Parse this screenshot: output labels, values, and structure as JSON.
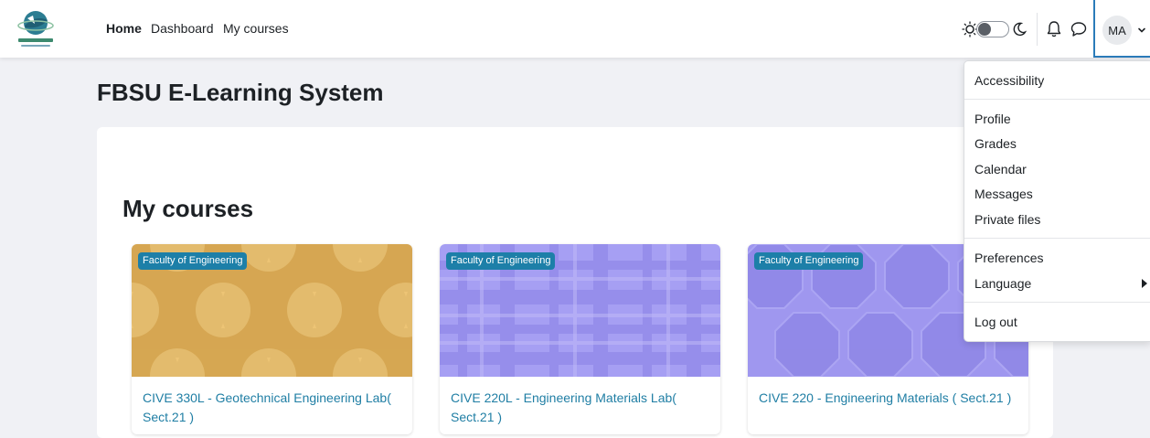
{
  "navbar": {
    "logo_icon": "university-logo-icon",
    "links": [
      {
        "label": "Home",
        "active": true
      },
      {
        "label": "Dashboard",
        "active": false
      },
      {
        "label": "My courses",
        "active": false
      }
    ],
    "theme_toggle": {
      "sun_icon": "sun-icon",
      "moon_icon": "moon-icon",
      "dark_mode": false
    },
    "notifications_icon": "bell-icon",
    "messages_icon": "chat-bubble-icon",
    "user_initials": "MA",
    "user_menu_icon": "chevron-down-icon"
  },
  "page": {
    "title": "FBSU E-Learning System",
    "section_title": "My courses"
  },
  "courses": [
    {
      "category": "Faculty of Engineering",
      "title": "CIVE 330L - Geotechnical Engineering Lab( Sect.21 )",
      "pattern": "circles",
      "color": "#e4b65e"
    },
    {
      "category": "Faculty of Engineering",
      "title": "CIVE 220L - Engineering Materials Lab( Sect.21 )",
      "pattern": "plaid",
      "color": "#a29bf2"
    },
    {
      "category": "Faculty of Engineering",
      "title": "CIVE 220 - Engineering Materials ( Sect.21 )",
      "pattern": "octagons",
      "color": "#9b93ee"
    }
  ],
  "user_menu": {
    "items": [
      {
        "label": "Accessibility"
      },
      {
        "label": "Profile"
      },
      {
        "label": "Grades"
      },
      {
        "label": "Calendar"
      },
      {
        "label": "Messages"
      },
      {
        "label": "Private files"
      },
      {
        "label": "Preferences"
      },
      {
        "label": "Language",
        "has_submenu": true
      },
      {
        "label": "Log out"
      }
    ]
  },
  "colors": {
    "link": "#1f7ea4",
    "badge": "#1d7fa8",
    "accent_border": "#2b7bb9",
    "page_bg": "#f0f1f5"
  }
}
